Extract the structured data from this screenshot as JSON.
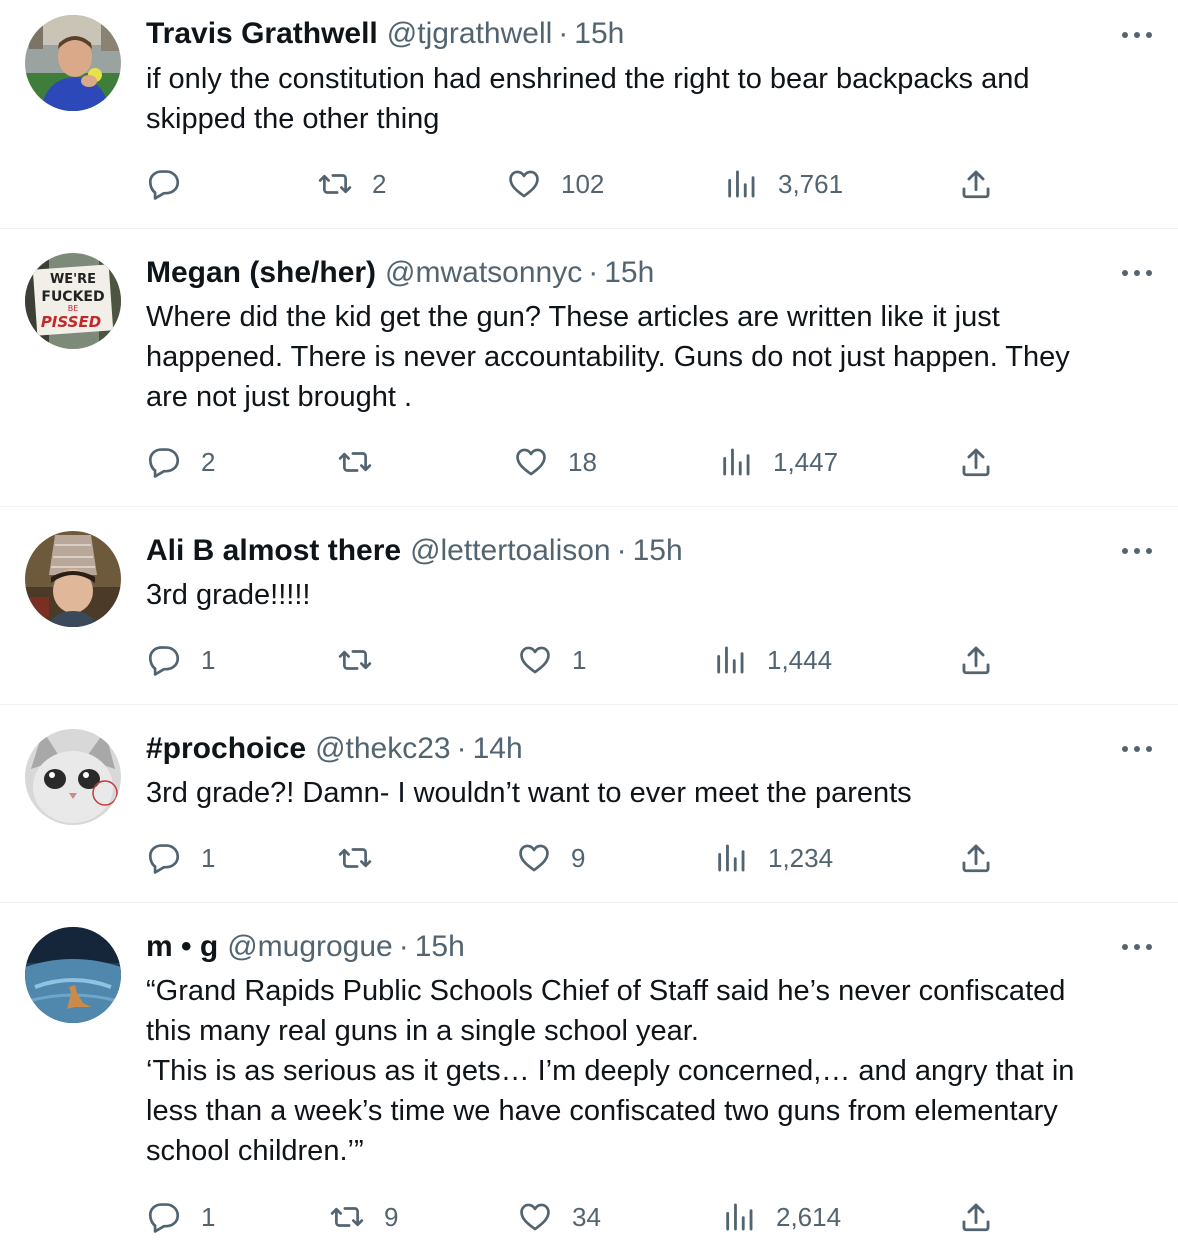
{
  "tweets": [
    {
      "name": "Travis Grathwell",
      "handle": "@tjgrathwell",
      "time": "15h",
      "text": "if only the constitution had enshrined the right to bear backpacks and\nskipped the other thing",
      "replies": "",
      "retweets": "2",
      "likes": "102",
      "views": "3,761"
    },
    {
      "name": "Megan (she/her)",
      "handle": "@mwatsonnyc",
      "time": "15h",
      "text": "Where did the kid get the gun? These articles are written like it just\nhappened. There is never accountability. Guns do not just happen. They\nare not just brought .",
      "replies": "2",
      "retweets": "",
      "likes": "18",
      "views": "1,447",
      "avatar_sign": [
        "WE'RE",
        "FUCKED",
        "BE",
        "PISSED"
      ]
    },
    {
      "name": "Ali B almost there",
      "handle": "@lettertoalison",
      "time": "15h",
      "text": "3rd grade!!!!!",
      "replies": "1",
      "retweets": "",
      "likes": "1",
      "views": "1,444"
    },
    {
      "name": "#prochoice",
      "handle": "@thekc23",
      "time": "14h",
      "text": "3rd grade?! Damn- I wouldn’t want to ever meet the parents",
      "replies": "1",
      "retweets": "",
      "likes": "9",
      "views": "1,234"
    },
    {
      "name": "m • g",
      "handle": "@mugrogue",
      "time": "15h",
      "text": "“Grand Rapids Public Schools Chief of Staff said he’s never confiscated\nthis many real guns in a single school year.\n‘This is as serious as it gets… I’m deeply concerned,… and angry that in\nless than a week’s time we have confiscated two guns from elementary\nschool children.’”",
      "replies": "1",
      "retweets": "9",
      "likes": "34",
      "views": "2,614"
    }
  ],
  "separator": "·",
  "icons": {
    "reply": "reply-icon",
    "retweet": "retweet-icon",
    "like": "heart-icon",
    "views": "views-icon",
    "share": "share-icon",
    "more": "more-icon"
  },
  "colors": {
    "text": "#0f1419",
    "secondary": "#536471",
    "divider": "#eff3f4"
  }
}
